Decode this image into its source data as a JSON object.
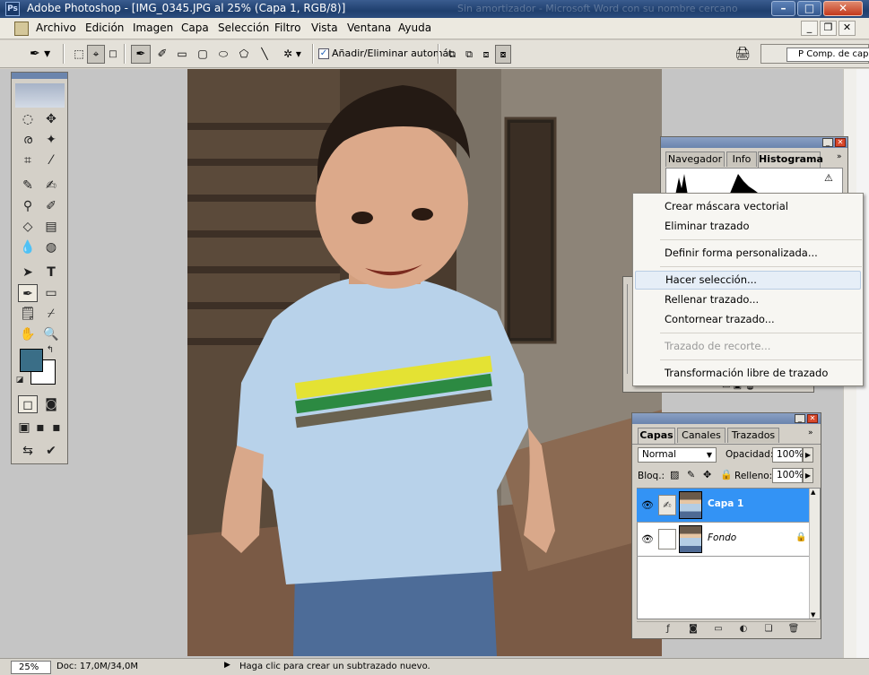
{
  "window": {
    "title": "Adobe Photoshop - [IMG_0345.JPG al 25% (Capa 1, RGB/8)]",
    "blurred_text": "Sin amortizador - Microsoft Word con su nombre cercano",
    "app_icon": "photoshop-icon"
  },
  "menubar": {
    "items": [
      "Archivo",
      "Edición",
      "Imagen",
      "Capa",
      "Selección",
      "Filtro",
      "Vista",
      "Ventana",
      "Ayuda"
    ]
  },
  "options": {
    "auto_label": "Añadir/Eliminar automát.",
    "auto_checked": true,
    "comp_label": "Comp. de cap",
    "comp_prefix": "P"
  },
  "histogram_panel": {
    "tabs": [
      "Navegador",
      "Info",
      "Histograma"
    ],
    "active_tab": "Histograma"
  },
  "context_menu": {
    "items": [
      {
        "label": "Crear máscara vectorial",
        "state": "normal"
      },
      {
        "label": "Eliminar trazado",
        "state": "normal"
      },
      {
        "label": "Definir forma personalizada...",
        "state": "normal"
      },
      {
        "label": "Hacer selección...",
        "state": "hover"
      },
      {
        "label": "Rellenar trazado...",
        "state": "normal"
      },
      {
        "label": "Contornear trazado...",
        "state": "normal"
      },
      {
        "label": "Trazado de recorte...",
        "state": "disabled"
      },
      {
        "label": "Transformación libre de trazado",
        "state": "normal"
      }
    ]
  },
  "layers_panel": {
    "tabs": [
      "Capas",
      "Canales",
      "Trazados"
    ],
    "active_tab": "Capas",
    "blend_mode": "Normal",
    "opacity_label": "Opacidad:",
    "opacity_value": "100%",
    "lock_label": "Bloq.:",
    "fill_label": "Relleno:",
    "fill_value": "100%",
    "layers": [
      {
        "name": "Capa 1",
        "selected": true,
        "visible": true,
        "locked": false
      },
      {
        "name": "Fondo",
        "selected": false,
        "visible": true,
        "locked": true
      }
    ]
  },
  "colors": {
    "foreground": "#3a6e87",
    "background": "#ffffff",
    "selection_blue": "#3393f5"
  },
  "status": {
    "zoom": "25%",
    "doc": "Doc: 17,0M/34,0M",
    "hint": "Haga clic para crear un subtrazado nuevo."
  }
}
